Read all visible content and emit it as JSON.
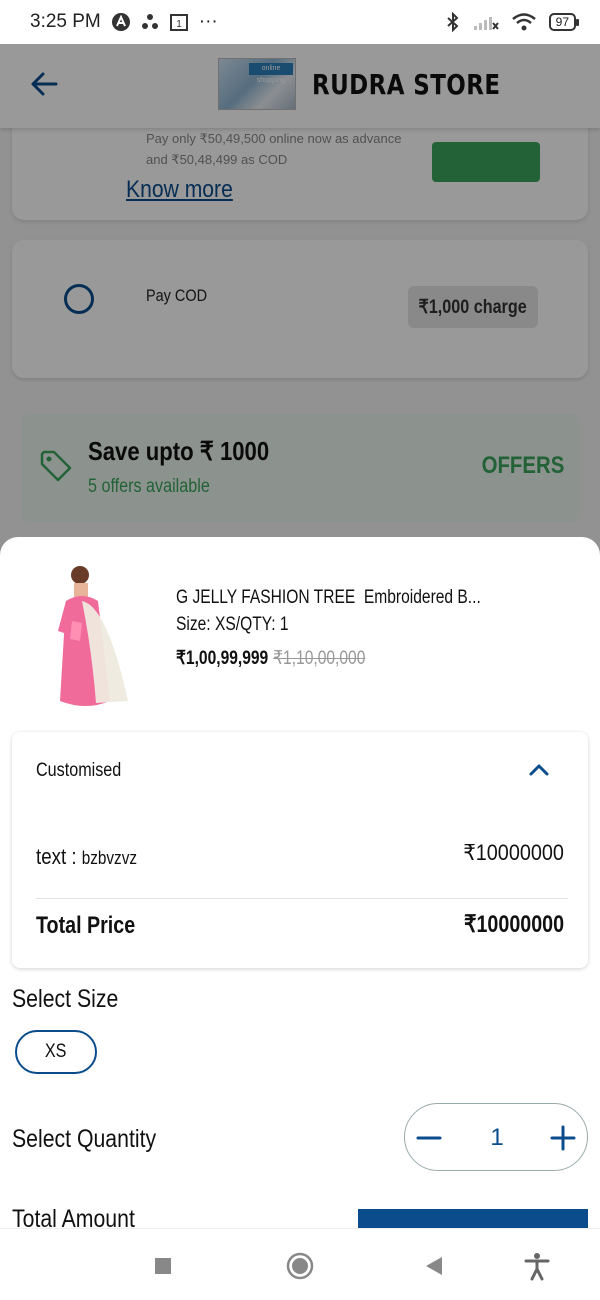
{
  "status_bar": {
    "time": "3:25 PM",
    "notif_badge": "1",
    "overflow": "···",
    "battery": "97"
  },
  "app_bar": {
    "title": "RUDRA STORE",
    "logo_alt": "online shopping"
  },
  "payment_options": {
    "advance": {
      "description": "Pay only ₹50,49,500 online now as advance and ₹50,48,499 as COD",
      "know_more": "Know more"
    },
    "cod": {
      "label": "Pay COD",
      "charge": "₹1,000 charge"
    }
  },
  "offers": {
    "title": "Save upto ₹ 1000",
    "subtitle": "5 offers available",
    "link": "OFFERS"
  },
  "product": {
    "name": "G JELLY FASHION TREE  Embroidered B...",
    "size_qty": "Size: XS/QTY: 1",
    "price": "₹1,00,99,999",
    "original_price": "₹1,10,00,000"
  },
  "customised": {
    "title": "Customised",
    "row_label": "text : ",
    "row_value": "bzbvzvz",
    "row_amount": "₹10000000",
    "total_label": "Total Price",
    "total_amount": "₹10000000"
  },
  "select_size": {
    "label": "Select Size",
    "options": [
      "XS"
    ],
    "selected": "XS"
  },
  "select_quantity": {
    "label": "Select Quantity",
    "value": "1"
  },
  "total_amount": {
    "label": "Total Amount"
  },
  "colors": {
    "primary": "#0b4c8c",
    "success": "#3aa35a",
    "offer_bg": "#eaf6ee"
  },
  "icons": [
    "back-arrow-icon",
    "tag-icon",
    "chevron-up-icon",
    "minus-icon",
    "plus-icon",
    "square-icon",
    "circle-icon",
    "triangle-back-icon",
    "accessibility-icon"
  ]
}
